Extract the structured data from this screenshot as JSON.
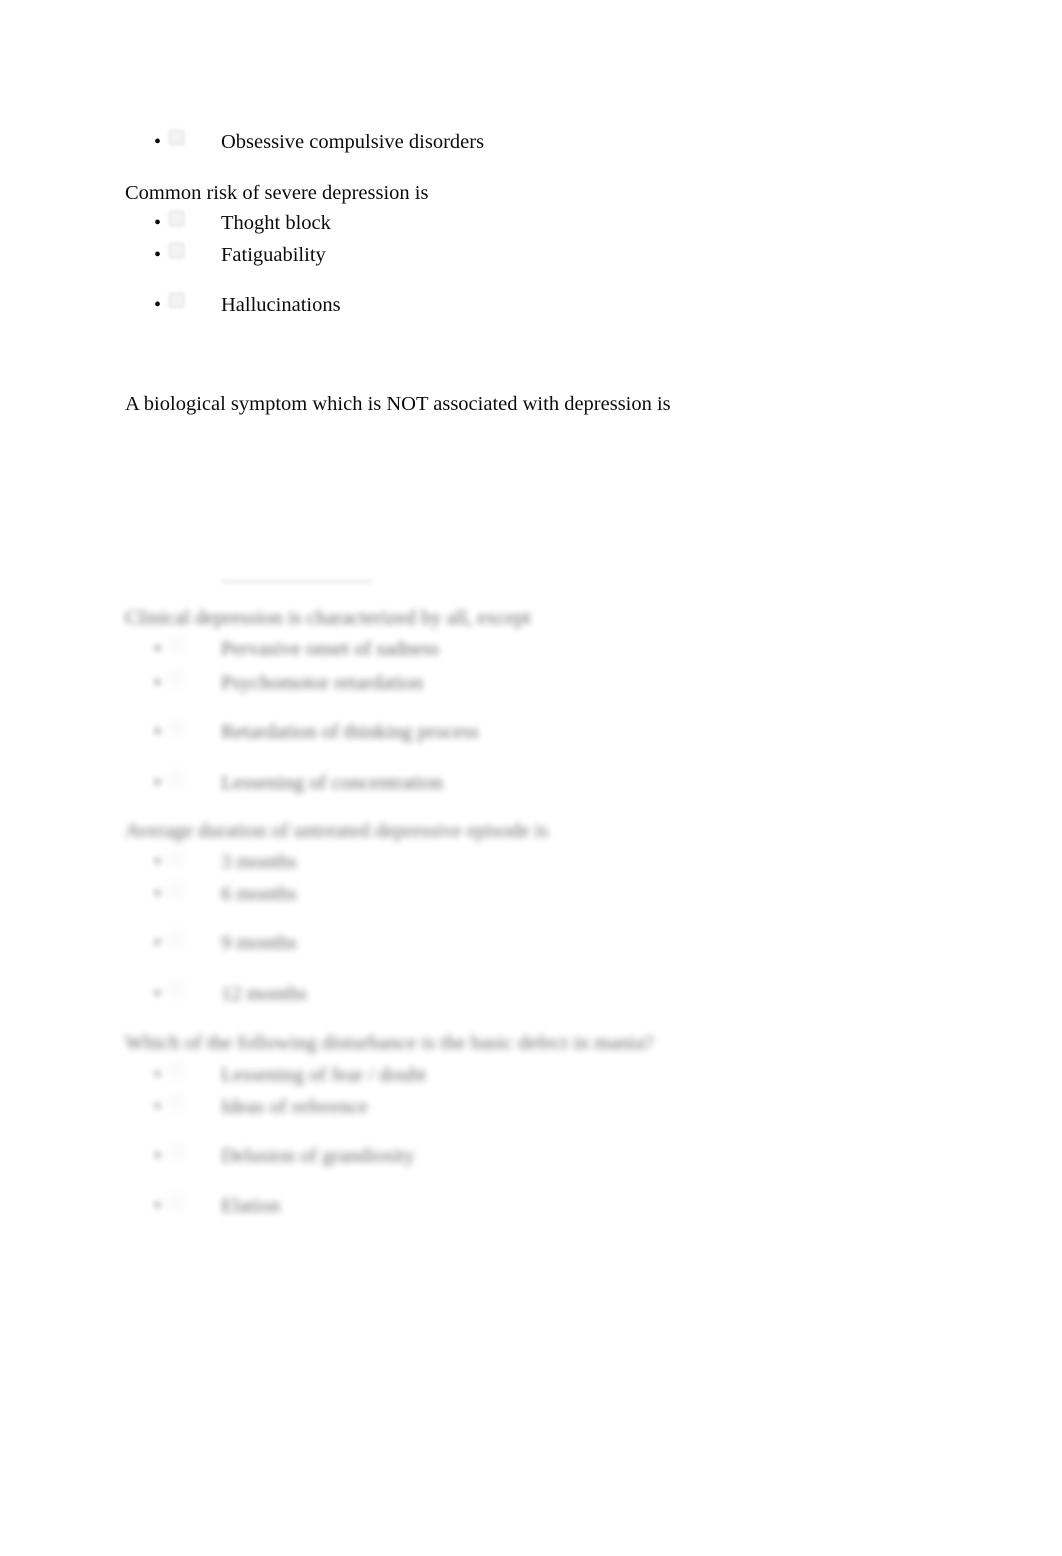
{
  "document": {
    "page_background": "#ffffff",
    "text_color": "#0b0b0b",
    "checkbox_fill": "#f2f2f2",
    "checkbox_border": "#cfcfcf"
  },
  "blocks": [
    {
      "id": "block-obsessive",
      "kind": "orphan-option",
      "clarity": "sharp",
      "options": [
        {
          "label": "Obsessive compulsive disorders",
          "bullet": "•",
          "checkbox": true
        }
      ]
    },
    {
      "id": "block-common-risk",
      "kind": "question",
      "clarity": "sharp",
      "question": "Common risk of severe depression is",
      "options": [
        {
          "label": "Thoght block",
          "bullet": "•",
          "checkbox": true
        },
        {
          "label": "Fatiguability",
          "bullet": "•",
          "checkbox": true
        },
        {
          "label": "Hallucinations",
          "bullet": "•",
          "checkbox": true
        }
      ]
    },
    {
      "id": "block-biological-symptom",
      "kind": "question",
      "clarity": "sharp",
      "question": "A biological symptom which is NOT associated with depression is",
      "options": []
    },
    {
      "id": "block-clinical-depression",
      "kind": "question",
      "clarity": "blurred",
      "question": "Clinical depression is characterized by all, except",
      "options": [
        {
          "label": "Pervasive onset of sadness",
          "bullet": "•",
          "checkbox": true
        },
        {
          "label": "Psychomotor retardation",
          "bullet": "•",
          "checkbox": true
        },
        {
          "label": "Retardation of thinking process",
          "bullet": "•",
          "checkbox": true
        },
        {
          "label": "Lessening of concentration",
          "bullet": "•",
          "checkbox": true
        }
      ]
    },
    {
      "id": "block-average-duration",
      "kind": "question",
      "clarity": "blurred",
      "question": "Average duration of untreated depressive episode is",
      "options": [
        {
          "label": "3 months",
          "bullet": "•",
          "checkbox": true
        },
        {
          "label": "6 months",
          "bullet": "•",
          "checkbox": true
        },
        {
          "label": "9 months",
          "bullet": "•",
          "checkbox": true
        },
        {
          "label": "12 months",
          "bullet": "•",
          "checkbox": true
        }
      ]
    },
    {
      "id": "block-basic-defect-mania",
      "kind": "question",
      "clarity": "blurred",
      "question": "Which of the following disturbance is the basic defect in mania?",
      "options": [
        {
          "label": "Lessening of fear / doubt",
          "bullet": "•",
          "checkbox": true
        },
        {
          "label": "Ideas of reference",
          "bullet": "•",
          "checkbox": true
        },
        {
          "label": "Delusion of grandiosity",
          "bullet": "•",
          "checkbox": true
        },
        {
          "label": "Elation",
          "bullet": "•",
          "checkbox": true
        }
      ]
    }
  ],
  "ghost_artifact": {
    "present": true,
    "description": "faint residual underline fragment above the blurred section"
  }
}
